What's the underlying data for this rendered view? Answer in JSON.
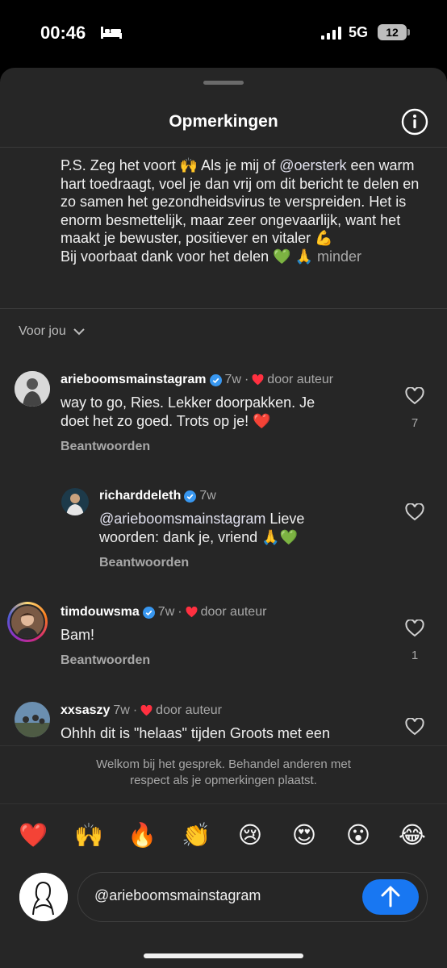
{
  "status": {
    "time": "00:46",
    "network": "5G",
    "battery": "12"
  },
  "sheet": {
    "title": "Opmerkingen"
  },
  "caption": {
    "line1_pre": "P.S. Zeg het voort 🙌 Als je mij of ",
    "mention": "@oersterk",
    "line1_post": " een warm hart toedraagt, voel je dan vrij om dit bericht te delen en zo samen het gezondheidsvirus te verspreiden. Het is enorm besmettelijk, maar zeer ongevaarlijk, want het maakt je bewuster, positiever en vitaler 💪",
    "line2": "Bij voorbaat dank voor het delen 💚 🙏",
    "more": "minder"
  },
  "filter": {
    "label": "Voor jou"
  },
  "comments": [
    {
      "user": "arieboomsmainstagram",
      "time": "7w",
      "author_like": "door auteur",
      "text": "way to go, Ries. Lekker doorpakken. Je doet het zo goed. Trots op je! ❤️",
      "reply": "Beantwoorden",
      "likes": "7"
    },
    {
      "user": "richarddeleth",
      "time": "7w",
      "mention": "@arieboomsmainstagram",
      "text": " Lieve woorden: dank je, vriend 🙏💚",
      "reply": "Beantwoorden"
    },
    {
      "user": "timdouwsma",
      "time": "7w",
      "author_like": "door auteur",
      "text": "Bam!",
      "reply": "Beantwoorden",
      "likes": "1"
    },
    {
      "user": "xxsaszy",
      "time": "7w",
      "author_like": "door auteur",
      "text": "Ohhh dit is \"helaas\" tijden Groots met een"
    }
  ],
  "welcome": {
    "line1": "Welkom bij het gesprek. Behandel anderen met",
    "line2": "respect als je opmerkingen plaatst."
  },
  "emojis": [
    "❤️",
    "🙌",
    "🔥",
    "👏",
    "😢",
    "😍",
    "😮",
    "😂"
  ],
  "composer": {
    "value": "@arieboomsmainstagram"
  },
  "colors": {
    "accent": "#1877f2",
    "like_red": "#ff3040",
    "sheet_bg": "#262626",
    "verified": "#3897f0"
  }
}
